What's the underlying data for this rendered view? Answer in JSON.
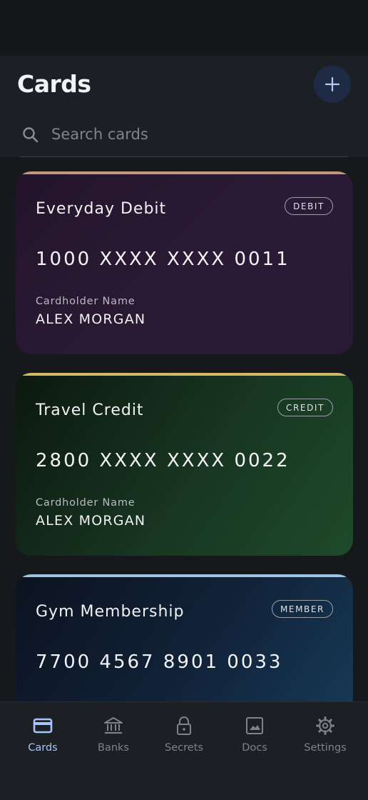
{
  "header": {
    "title": "Cards",
    "add_icon": "plus-icon"
  },
  "search": {
    "placeholder": "Search cards",
    "value": "",
    "icon": "search-icon"
  },
  "cards": [
    {
      "name": "Everyday Debit",
      "badge": "DEBIT",
      "number": "1000 XXXX XXXX 0011",
      "holder_label": "Cardholder Name",
      "holder": "ALEX MORGAN",
      "accent": "#c2987a"
    },
    {
      "name": "Travel Credit",
      "badge": "CREDIT",
      "number": "2800 XXXX XXXX 0022",
      "holder_label": "Cardholder Name",
      "holder": "ALEX MORGAN",
      "accent": "#d3b86c"
    },
    {
      "name": "Gym Membership",
      "badge": "MEMBER",
      "number": "7700 4567 8901 0033",
      "holder_label": "",
      "holder": "",
      "accent": "#9fc3e0"
    }
  ],
  "nav": [
    {
      "label": "Cards",
      "icon": "credit-card-icon",
      "active": true
    },
    {
      "label": "Banks",
      "icon": "bank-icon",
      "active": false
    },
    {
      "label": "Secrets",
      "icon": "lock-icon",
      "active": false
    },
    {
      "label": "Docs",
      "icon": "image-icon",
      "active": false
    },
    {
      "label": "Settings",
      "icon": "gear-icon",
      "active": false
    }
  ],
  "colors": {
    "background": "#17181c",
    "surface": "#1c1f24",
    "accent": "#a9c3ff",
    "muted": "#7e838b"
  }
}
